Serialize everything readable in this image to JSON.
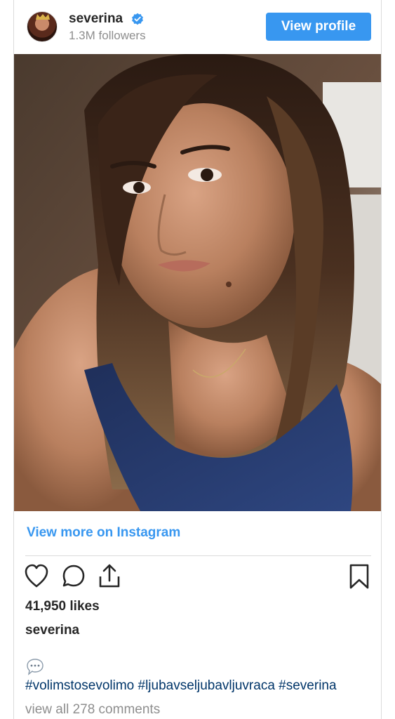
{
  "header": {
    "username": "severina",
    "followers": "1.3M followers",
    "view_profile_label": "View profile",
    "verified_icon": "verified-badge-icon"
  },
  "post": {
    "view_more_label": "View more on Instagram",
    "likes": "41,950 likes",
    "caption_username": "severina",
    "hashtags": "#volimstosevolimo #ljubavseljubavljuvraca #severina",
    "view_comments": "view all 278 comments"
  },
  "icons": {
    "like": "heart-icon",
    "comment": "comment-bubble-icon",
    "share": "share-icon",
    "save": "bookmark-icon",
    "speech": "speech-bubble-emoji-icon"
  },
  "colors": {
    "accent": "#3897f0",
    "hashtag": "#003569",
    "muted": "#8e8e8e",
    "text": "#262626"
  }
}
